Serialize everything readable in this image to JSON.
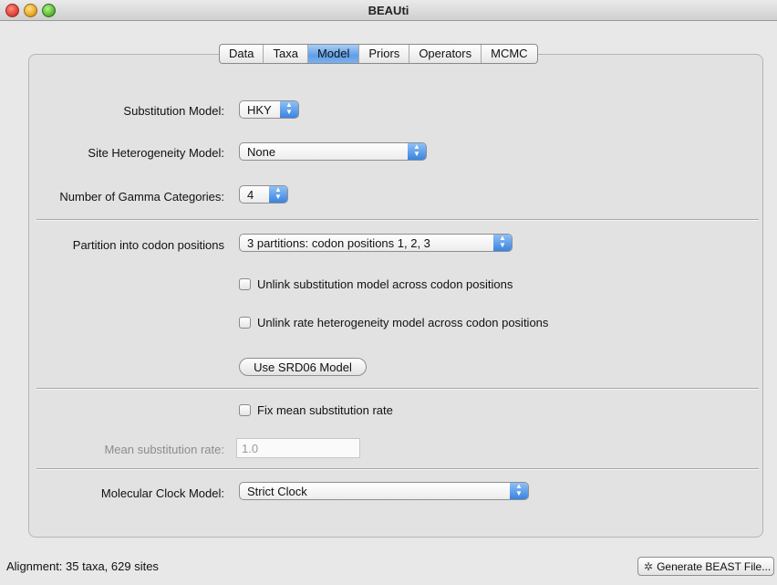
{
  "window": {
    "title": "BEAUti"
  },
  "tabs": [
    {
      "label": "Data"
    },
    {
      "label": "Taxa"
    },
    {
      "label": "Model",
      "active": true
    },
    {
      "label": "Priors"
    },
    {
      "label": "Operators"
    },
    {
      "label": "MCMC"
    }
  ],
  "model": {
    "substitution_label": "Substitution Model:",
    "substitution_value": "HKY",
    "site_het_label": "Site Heterogeneity Model:",
    "site_het_value": "None",
    "gamma_label": "Number of Gamma Categories:",
    "gamma_value": "4",
    "partition_label": "Partition into codon positions",
    "partition_value": "3 partitions: codon positions 1, 2, 3",
    "unlink_subst_label": "Unlink substitution model across codon positions",
    "unlink_rate_label": "Unlink rate heterogeneity model across codon positions",
    "srd06_button": "Use SRD06 Model",
    "fix_rate_label": "Fix mean substitution rate",
    "mean_rate_label": "Mean substitution rate:",
    "mean_rate_value": "1.0",
    "clock_label": "Molecular Clock Model:",
    "clock_value": "Strict Clock"
  },
  "status": {
    "text": "Alignment: 35 taxa, 629 sites"
  },
  "generate_button": {
    "label": "Generate BEAST File...",
    "icon": "gear-icon"
  },
  "colors": {
    "accent": "#3a83e0",
    "tab_active": "#5f9fe8"
  }
}
